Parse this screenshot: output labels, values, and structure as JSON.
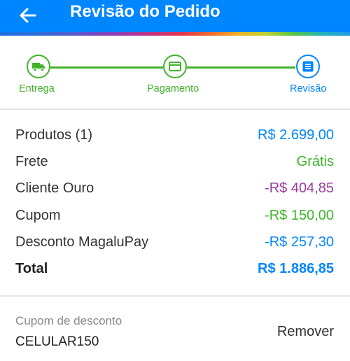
{
  "header": {
    "title": "Revisão do Pedido",
    "back_icon": "arrow-left-icon"
  },
  "steps": [
    {
      "label": "Entrega",
      "icon": "truck-icon",
      "state": "done"
    },
    {
      "label": "Pagamento",
      "icon": "credit-card-icon",
      "state": "done"
    },
    {
      "label": "Revisão",
      "icon": "list-icon",
      "state": "current"
    }
  ],
  "summary": {
    "rows": [
      {
        "label": "Produtos (1)",
        "value": "R$ 2.699,00",
        "color": "#0086ff"
      },
      {
        "label": "Frete",
        "value": "Grátis",
        "color": "#3fb429"
      },
      {
        "label": "Cliente Ouro",
        "value": "-R$ 404,85",
        "color": "#9b3a9e"
      },
      {
        "label": "Cupom",
        "value": "-R$ 150,00",
        "color": "#3fb429"
      },
      {
        "label": "Desconto MagaluPay",
        "value": "-R$ 257,30",
        "color": "#0086ff"
      }
    ],
    "total": {
      "label": "Total",
      "value": "R$ 1.886,85",
      "color": "#0086ff"
    }
  },
  "coupon": {
    "label": "Cupom de desconto",
    "code": "CELULAR150",
    "remove_label": "Remover"
  },
  "colors": {
    "brand": "#0086ff",
    "success": "#3fb429",
    "gold": "#9b3a9e"
  }
}
